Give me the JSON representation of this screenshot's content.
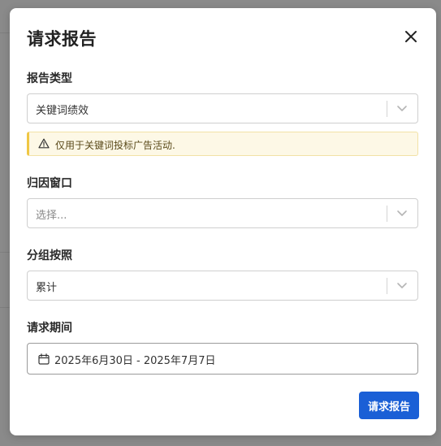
{
  "modal": {
    "title": "请求报告",
    "close_icon": "close-icon"
  },
  "report_type": {
    "label": "报告类型",
    "value": "关键词绩效"
  },
  "warning": {
    "icon": "warning-icon",
    "text": "仅用于关键词投标广告活动."
  },
  "attribution_window": {
    "label": "归因窗口",
    "placeholder": "选择..."
  },
  "group_by": {
    "label": "分组按照",
    "value": "累计"
  },
  "request_period": {
    "label": "请求期间",
    "icon": "calendar-icon",
    "value": "2025年6月30日 - 2025年7月7日"
  },
  "actions": {
    "submit_label": "请求报告"
  },
  "colors": {
    "primary": "#1a5fd6",
    "warning_accent": "#f0c744",
    "warning_bg": "#fdf8e6"
  }
}
